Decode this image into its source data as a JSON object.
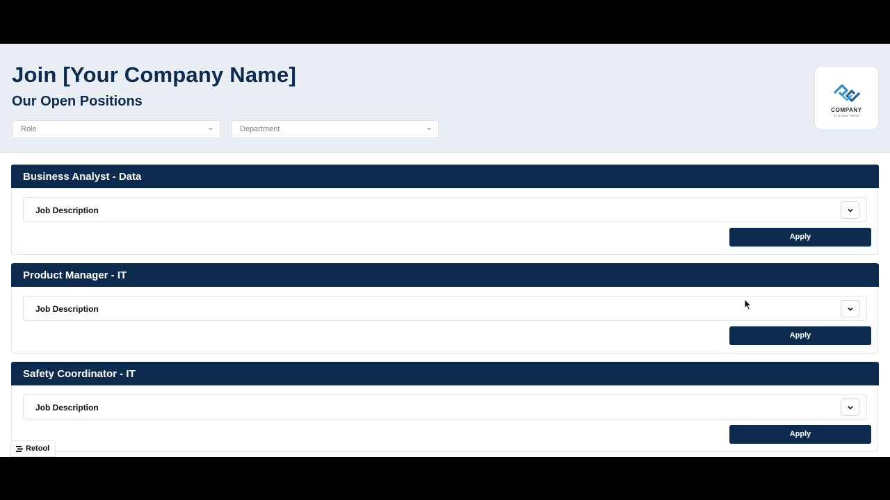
{
  "header": {
    "title": "Join [Your Company Name]",
    "subtitle": "Our Open Positions",
    "filters": {
      "role_placeholder": "Role",
      "department_placeholder": "Department"
    },
    "logo": {
      "word": "COMPANY",
      "slogan": "SLOGAN HERE",
      "color": "#2a8fd0"
    }
  },
  "jobs": [
    {
      "title": "Business Analyst - Data",
      "description_label": "Job Description",
      "apply_label": "Apply"
    },
    {
      "title": "Product Manager - IT",
      "description_label": "Job Description",
      "apply_label": "Apply"
    },
    {
      "title": "Safety Coordinator - IT",
      "description_label": "Job Description",
      "apply_label": "Apply"
    }
  ],
  "footer": {
    "retool_label": "Retool"
  },
  "colors": {
    "primary": "#0d2a4f",
    "header_bg": "#e8eef3"
  }
}
